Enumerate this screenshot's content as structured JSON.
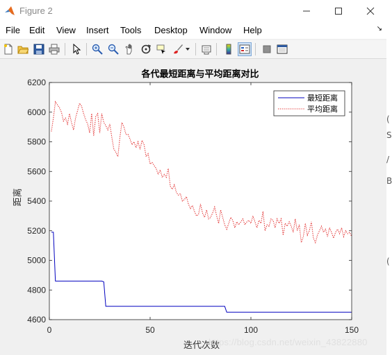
{
  "window": {
    "title": "Figure 2",
    "minimize_label": "—",
    "maximize_label": "☐",
    "close_label": "✕"
  },
  "menu": {
    "items": [
      "File",
      "Edit",
      "View",
      "Insert",
      "Tools",
      "Desktop",
      "Window",
      "Help"
    ],
    "dock_arrow": "↘"
  },
  "toolbar": {
    "icons": [
      "new-figure-icon",
      "open-file-icon",
      "save-icon",
      "print-icon",
      "pointer-icon",
      "zoom-in-icon",
      "zoom-out-icon",
      "pan-icon",
      "rotate-icon",
      "data-cursor-icon",
      "brush-icon",
      "link-plot-icon",
      "colorbar-icon",
      "legend-icon",
      "hide-plot-tools-icon",
      "show-plot-tools-icon"
    ]
  },
  "colors": {
    "series1": "#0000bf",
    "series2": "#e02020",
    "axes": "#262626"
  },
  "chart_data": {
    "type": "line",
    "title": "各代最短距离与平均距离对比",
    "xlabel": "迭代次数",
    "ylabel": "距离",
    "xlim": [
      0,
      150
    ],
    "ylim": [
      4600,
      6200
    ],
    "xticks": [
      "0",
      "50",
      "100",
      "150"
    ],
    "yticks": [
      "4600",
      "4800",
      "5000",
      "5200",
      "5400",
      "5600",
      "5800",
      "6000",
      "6200"
    ],
    "grid": false,
    "legend_position": "top-right",
    "series": [
      {
        "name": "最短距离",
        "style": "solid",
        "x": [
          1,
          2,
          3,
          4,
          26,
          27,
          28,
          87,
          88,
          150
        ],
        "y": [
          5190,
          5190,
          4860,
          4860,
          4860,
          4855,
          4690,
          4690,
          4650,
          4650
        ]
      },
      {
        "name": "平均距离",
        "style": "dotted",
        "x": [
          1,
          2,
          3,
          4,
          5,
          6,
          7,
          8,
          9,
          10,
          11,
          12,
          13,
          14,
          15,
          16,
          17,
          18,
          19,
          20,
          21,
          22,
          23,
          24,
          25,
          26,
          27,
          28,
          29,
          30,
          31,
          32,
          33,
          34,
          35,
          36,
          37,
          38,
          39,
          40,
          41,
          42,
          43,
          44,
          45,
          46,
          47,
          48,
          49,
          50,
          51,
          52,
          53,
          54,
          55,
          56,
          57,
          58,
          59,
          60,
          61,
          62,
          63,
          64,
          65,
          66,
          67,
          68,
          69,
          70,
          71,
          72,
          73,
          74,
          75,
          76,
          77,
          78,
          79,
          80,
          81,
          82,
          83,
          84,
          85,
          86,
          87,
          88,
          89,
          90,
          91,
          92,
          93,
          94,
          95,
          96,
          97,
          98,
          99,
          100,
          101,
          102,
          103,
          104,
          105,
          106,
          107,
          108,
          109,
          110,
          111,
          112,
          113,
          114,
          115,
          116,
          117,
          118,
          119,
          120,
          121,
          122,
          123,
          124,
          125,
          126,
          127,
          128,
          129,
          130,
          131,
          132,
          133,
          134,
          135,
          136,
          137,
          138,
          139,
          140,
          141,
          142,
          143,
          144,
          145,
          146,
          147,
          148,
          149,
          150
        ],
        "y": [
          5870,
          5960,
          6070,
          6050,
          6030,
          6000,
          5940,
          5960,
          5920,
          5990,
          5930,
          5880,
          5960,
          6010,
          6060,
          6040,
          5990,
          5950,
          5920,
          5860,
          5990,
          5840,
          5970,
          5990,
          5860,
          5990,
          5930,
          5910,
          5880,
          5920,
          5830,
          5750,
          5730,
          5700,
          5830,
          5930,
          5900,
          5850,
          5850,
          5820,
          5780,
          5800,
          5760,
          5800,
          5750,
          5810,
          5780,
          5700,
          5720,
          5650,
          5660,
          5640,
          5620,
          5580,
          5610,
          5560,
          5580,
          5560,
          5620,
          5500,
          5480,
          5510,
          5460,
          5440,
          5450,
          5400,
          5410,
          5430,
          5380,
          5350,
          5370,
          5330,
          5300,
          5310,
          5380,
          5320,
          5290,
          5340,
          5280,
          5290,
          5320,
          5360,
          5300,
          5250,
          5340,
          5290,
          5240,
          5210,
          5250,
          5290,
          5270,
          5220,
          5260,
          5240,
          5260,
          5280,
          5240,
          5260,
          5270,
          5250,
          5300,
          5260,
          5220,
          5270,
          5250,
          5330,
          5200,
          5240,
          5230,
          5280,
          5270,
          5220,
          5280,
          5250,
          5280,
          5170,
          5250,
          5230,
          5260,
          5230,
          5190,
          5280,
          5200,
          5240,
          5120,
          5160,
          5250,
          5170,
          5200,
          5260,
          5150,
          5120,
          5170,
          5200,
          5230,
          5190,
          5210,
          5160,
          5220,
          5190,
          5150,
          5190,
          5210,
          5180,
          5220,
          5160,
          5200,
          5180,
          5190,
          5160
        ]
      }
    ]
  },
  "watermark": "https://blog.csdn.net/weixin_43822880",
  "right_edge_fragments": [
    "(",
    "S",
    "/",
    "B",
    "("
  ]
}
